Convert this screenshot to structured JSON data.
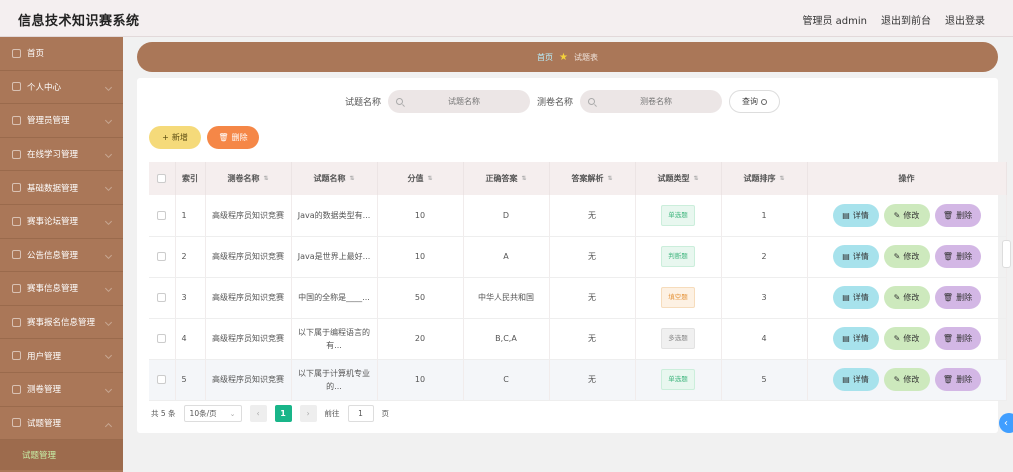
{
  "app": {
    "title": "信息技术知识赛系统"
  },
  "topnav": {
    "user": "管理员 admin",
    "to_front": "退出到前台",
    "logout": "退出登录"
  },
  "sidebar": {
    "items": [
      {
        "label": "首页",
        "icon": "home-icon"
      },
      {
        "label": "个人中心",
        "icon": "user-icon"
      },
      {
        "label": "管理员管理",
        "icon": "admin-icon"
      },
      {
        "label": "在线学习管理",
        "icon": "study-icon"
      },
      {
        "label": "基础数据管理",
        "icon": "data-icon"
      },
      {
        "label": "赛事论坛管理",
        "icon": "forum-icon"
      },
      {
        "label": "公告信息管理",
        "icon": "notice-icon"
      },
      {
        "label": "赛事信息管理",
        "icon": "event-icon"
      },
      {
        "label": "赛事报名信息管理",
        "icon": "signup-icon"
      },
      {
        "label": "用户管理",
        "icon": "users-icon"
      },
      {
        "label": "测卷管理",
        "icon": "paper-icon"
      },
      {
        "label": "试题管理",
        "icon": "question-icon"
      }
    ],
    "active_sub": "试题管理"
  },
  "breadcrumb": {
    "home": "首页",
    "current": "试题表"
  },
  "search": {
    "question_label": "试题名称",
    "question_placeholder": "试题名称",
    "paper_label": "测卷名称",
    "paper_placeholder": "测卷名称",
    "query_button": "查询"
  },
  "actions": {
    "add": "新增",
    "delete": "删除"
  },
  "table": {
    "headers": [
      "索引",
      "测卷名称",
      "试题名称",
      "分值",
      "正确答案",
      "答案解析",
      "试题类型",
      "试题排序",
      "操作"
    ],
    "rows": [
      {
        "index": "1",
        "paper": "高级程序员知识竞赛",
        "question": "Java的数据类型有...",
        "score": "10",
        "answer": "D",
        "analysis": "无",
        "type": "单选题",
        "type_style": "single",
        "order": "1"
      },
      {
        "index": "2",
        "paper": "高级程序员知识竞赛",
        "question": "Java是世界上最好...",
        "score": "10",
        "answer": "A",
        "analysis": "无",
        "type": "判断题",
        "type_style": "judge",
        "order": "2"
      },
      {
        "index": "3",
        "paper": "高级程序员知识竞赛",
        "question": "中国的全称是____...",
        "score": "50",
        "answer": "中华人民共和国",
        "analysis": "无",
        "type": "填空题",
        "type_style": "fill",
        "order": "3"
      },
      {
        "index": "4",
        "paper": "高级程序员知识竞赛",
        "question": "以下属于编程语言的有...",
        "score": "20",
        "answer": "B,C,A",
        "analysis": "无",
        "type": "多选题",
        "type_style": "multi",
        "order": "4"
      },
      {
        "index": "5",
        "paper": "高级程序员知识竞赛",
        "question": "以下属于计算机专业的...",
        "score": "10",
        "answer": "C",
        "analysis": "无",
        "type": "单选题",
        "type_style": "single",
        "order": "5"
      }
    ],
    "row_actions": {
      "detail": "详情",
      "edit": "修改",
      "delete": "删除"
    }
  },
  "pagination": {
    "total": "共 5 条",
    "page_size": "10条/页",
    "current_page": "1",
    "goto_label": "前往",
    "goto_value": "1",
    "page_unit": "页"
  },
  "colors": {
    "primary": "#aa7758",
    "accent_green": "#19b589",
    "add_button": "#f5da7a",
    "delete_button": "#f58747"
  }
}
